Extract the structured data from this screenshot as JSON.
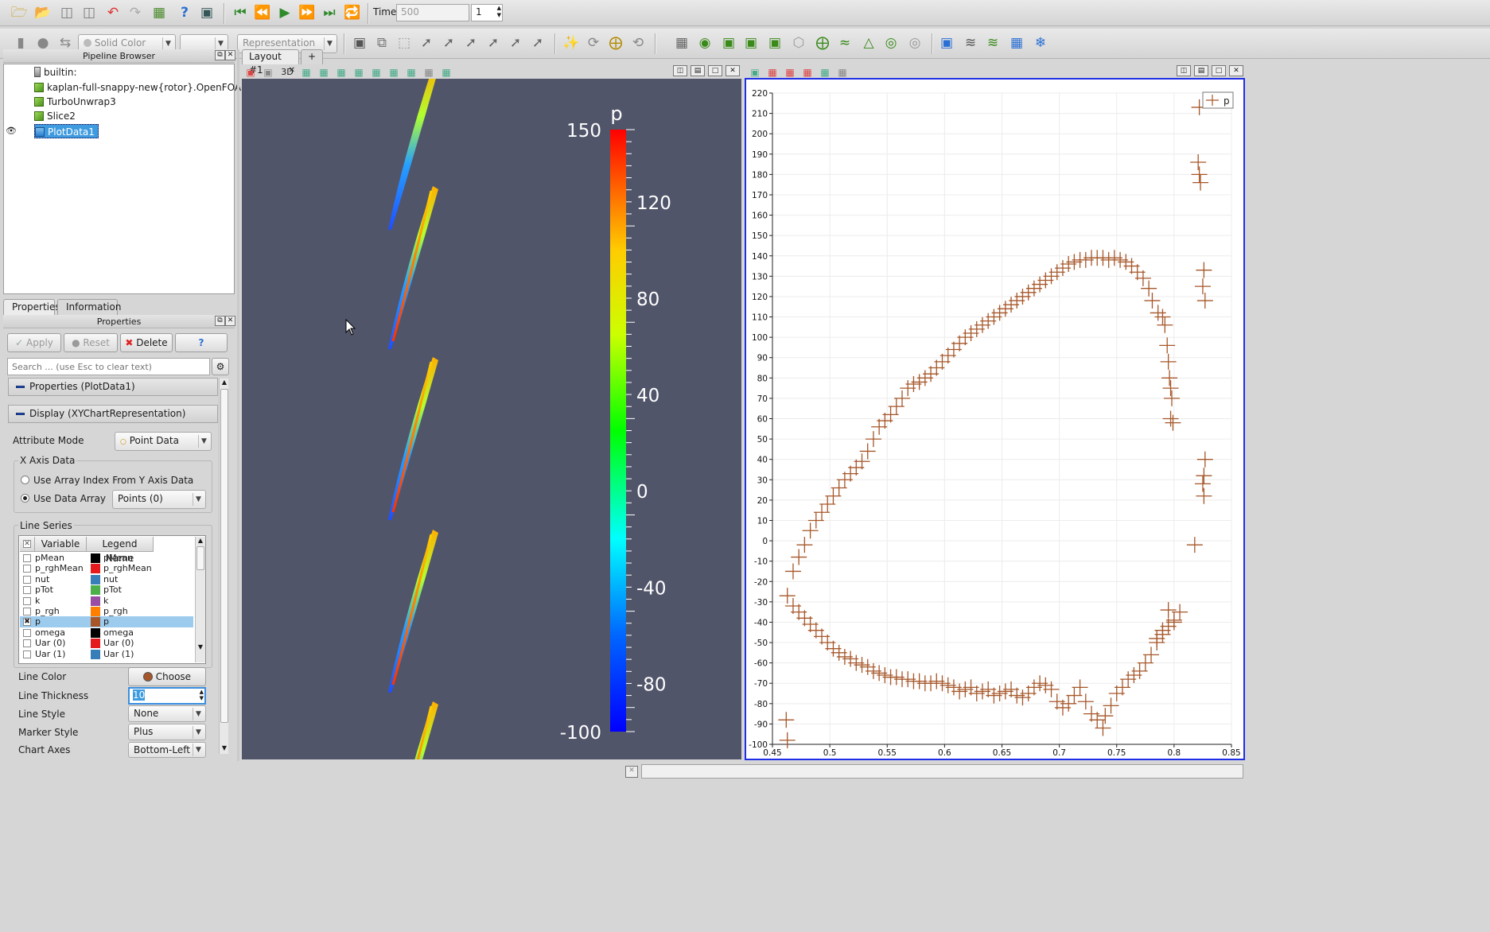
{
  "toolbar1": {
    "time_label": "Time:",
    "time_value": "500",
    "timestep_value": "1"
  },
  "toolbar2": {
    "color_combo": "Solid Color",
    "component_combo": "",
    "representation_combo": "Representation"
  },
  "pipeline_browser": {
    "title": "Pipeline Browser",
    "items": [
      {
        "label": "builtin:"
      },
      {
        "label": "kaplan-full-snappy-new{rotor}.OpenFOAM"
      },
      {
        "label": "TurboUnwrap3"
      },
      {
        "label": "Slice2"
      },
      {
        "label": "PlotData1",
        "selected": true,
        "visible": true
      }
    ]
  },
  "tabs": {
    "properties": "Properties",
    "information": "Information"
  },
  "properties_panel": {
    "title": "Properties",
    "apply": "Apply",
    "reset": "Reset",
    "delete": "Delete",
    "help": "?",
    "search_placeholder": "Search ... (use Esc to clear text)",
    "section_properties": "Properties (PlotData1)",
    "section_display": "Display (XYChartRepresentation)",
    "attribute_mode_label": "Attribute Mode",
    "attribute_mode_value": "Point Data",
    "x_axis_group": "X Axis Data",
    "x_axis_option1": "Use Array Index From Y Axis Data",
    "x_axis_option2": "Use Data Array",
    "x_axis_array": "Points (0)",
    "line_series_group": "Line Series",
    "col_variable": "Variable",
    "col_legend": "Legend Name",
    "series": [
      {
        "variable": "pMean",
        "legend": "pMean",
        "color": "#000000",
        "checked": false
      },
      {
        "variable": "p_rghMean",
        "legend": "p_rghMean",
        "color": "#e41a1c",
        "checked": false
      },
      {
        "variable": "nut",
        "legend": "nut",
        "color": "#377eb8",
        "checked": false
      },
      {
        "variable": "pTot",
        "legend": "pTot",
        "color": "#4daf4a",
        "checked": false
      },
      {
        "variable": "k",
        "legend": "k",
        "color": "#984ea3",
        "checked": false
      },
      {
        "variable": "p_rgh",
        "legend": "p_rgh",
        "color": "#ff7f00",
        "checked": false
      },
      {
        "variable": "p",
        "legend": "p",
        "color": "#a65628",
        "checked": true
      },
      {
        "variable": "omega",
        "legend": "omega",
        "color": "#000000",
        "checked": false
      },
      {
        "variable": "Uar (0)",
        "legend": "Uar (0)",
        "color": "#e41a1c",
        "checked": false
      },
      {
        "variable": "Uar (1)",
        "legend": "Uar (1)",
        "color": "#377eb8",
        "checked": false
      }
    ],
    "line_color_label": "Line Color",
    "line_color_button": "Choose Color...",
    "line_thickness_label": "Line Thickness",
    "line_thickness_value": "10",
    "line_style_label": "Line Style",
    "line_style_value": "None",
    "marker_style_label": "Marker Style",
    "marker_style_value": "Plus",
    "chart_axes_label": "Chart Axes",
    "chart_axes_value": "Bottom-Left"
  },
  "layout": {
    "tab_label": "Layout #1",
    "add_tab": "+",
    "view_3d_label": "3D"
  },
  "colors": {
    "series": "#a65628",
    "chart_border": "#1f2ee6",
    "render_bg": "#51556a"
  },
  "colorbar": {
    "title": "p",
    "min_label": "-100",
    "max_label": "150",
    "tick_labels": [
      "120",
      "80",
      "40",
      "0",
      "-40",
      "-80"
    ]
  },
  "chart_data": {
    "type": "scatter",
    "marker": "plus",
    "xlim": [
      0.45,
      0.85
    ],
    "ylim": [
      -100,
      220
    ],
    "x_ticks": [
      "0.45",
      "0.5",
      "0.55",
      "0.6",
      "0.65",
      "0.7",
      "0.75",
      "0.8",
      "0.85"
    ],
    "y_ticks": [
      "220",
      "210",
      "200",
      "190",
      "180",
      "170",
      "160",
      "150",
      "140",
      "130",
      "120",
      "110",
      "100",
      "90",
      "80",
      "70",
      "60",
      "50",
      "40",
      "30",
      "20",
      "10",
      "0",
      "-10",
      "-20",
      "-30",
      "-40",
      "-50",
      "-60",
      "-70",
      "-80",
      "-90",
      "-100"
    ],
    "legend_position": "top-right",
    "grid": true,
    "series": [
      {
        "name": "p",
        "points": [
          [
            0.463,
            -27
          ],
          [
            0.468,
            -32
          ],
          [
            0.473,
            -35
          ],
          [
            0.478,
            -38
          ],
          [
            0.483,
            -41
          ],
          [
            0.488,
            -44
          ],
          [
            0.493,
            -47
          ],
          [
            0.498,
            -50
          ],
          [
            0.503,
            -53
          ],
          [
            0.508,
            -55
          ],
          [
            0.513,
            -57
          ],
          [
            0.518,
            -58
          ],
          [
            0.523,
            -60
          ],
          [
            0.528,
            -61
          ],
          [
            0.533,
            -62
          ],
          [
            0.538,
            -64
          ],
          [
            0.543,
            -65
          ],
          [
            0.548,
            -66
          ],
          [
            0.553,
            -67
          ],
          [
            0.558,
            -67
          ],
          [
            0.563,
            -68
          ],
          [
            0.568,
            -68
          ],
          [
            0.573,
            -69
          ],
          [
            0.578,
            -69
          ],
          [
            0.583,
            -70
          ],
          [
            0.588,
            -70
          ],
          [
            0.593,
            -69
          ],
          [
            0.598,
            -70
          ],
          [
            0.603,
            -71
          ],
          [
            0.608,
            -72
          ],
          [
            0.613,
            -74
          ],
          [
            0.618,
            -73
          ],
          [
            0.623,
            -72
          ],
          [
            0.628,
            -75
          ],
          [
            0.633,
            -74
          ],
          [
            0.638,
            -73
          ],
          [
            0.643,
            -76
          ],
          [
            0.648,
            -75
          ],
          [
            0.653,
            -74
          ],
          [
            0.658,
            -73
          ],
          [
            0.663,
            -76
          ],
          [
            0.668,
            -77
          ],
          [
            0.673,
            -75
          ],
          [
            0.678,
            -72
          ],
          [
            0.683,
            -70
          ],
          [
            0.688,
            -71
          ],
          [
            0.693,
            -73
          ],
          [
            0.698,
            -79
          ],
          [
            0.703,
            -82
          ],
          [
            0.708,
            -80
          ],
          [
            0.713,
            -76
          ],
          [
            0.718,
            -72
          ],
          [
            0.723,
            -79
          ],
          [
            0.728,
            -85
          ],
          [
            0.733,
            -88
          ],
          [
            0.738,
            -92
          ],
          [
            0.74,
            -86
          ],
          [
            0.745,
            -81
          ],
          [
            0.75,
            -75
          ],
          [
            0.755,
            -72
          ],
          [
            0.76,
            -68
          ],
          [
            0.765,
            -66
          ],
          [
            0.77,
            -64
          ],
          [
            0.775,
            -60
          ],
          [
            0.78,
            -56
          ],
          [
            0.785,
            -50
          ],
          [
            0.79,
            -46
          ],
          [
            0.795,
            -42
          ],
          [
            0.8,
            -39
          ],
          [
            0.805,
            -35
          ],
          [
            0.79,
            -44
          ],
          [
            0.785,
            -48
          ],
          [
            0.795,
            -34
          ],
          [
            0.8,
            -40
          ],
          [
            0.468,
            -15
          ],
          [
            0.473,
            -8
          ],
          [
            0.478,
            -2
          ],
          [
            0.483,
            5
          ],
          [
            0.488,
            10
          ],
          [
            0.493,
            14
          ],
          [
            0.498,
            18
          ],
          [
            0.503,
            22
          ],
          [
            0.508,
            26
          ],
          [
            0.513,
            30
          ],
          [
            0.518,
            33
          ],
          [
            0.523,
            36
          ],
          [
            0.528,
            39
          ],
          [
            0.533,
            44
          ],
          [
            0.538,
            50
          ],
          [
            0.543,
            56
          ],
          [
            0.548,
            59
          ],
          [
            0.553,
            62
          ],
          [
            0.558,
            66
          ],
          [
            0.563,
            70
          ],
          [
            0.568,
            75
          ],
          [
            0.573,
            77
          ],
          [
            0.578,
            78
          ],
          [
            0.583,
            80
          ],
          [
            0.588,
            82
          ],
          [
            0.593,
            85
          ],
          [
            0.598,
            88
          ],
          [
            0.603,
            91
          ],
          [
            0.608,
            94
          ],
          [
            0.613,
            97
          ],
          [
            0.618,
            100
          ],
          [
            0.623,
            102
          ],
          [
            0.628,
            104
          ],
          [
            0.633,
            106
          ],
          [
            0.638,
            108
          ],
          [
            0.643,
            110
          ],
          [
            0.648,
            112
          ],
          [
            0.653,
            114
          ],
          [
            0.658,
            116
          ],
          [
            0.663,
            118
          ],
          [
            0.668,
            120
          ],
          [
            0.673,
            122
          ],
          [
            0.678,
            124
          ],
          [
            0.683,
            126
          ],
          [
            0.688,
            128
          ],
          [
            0.693,
            130
          ],
          [
            0.698,
            132
          ],
          [
            0.703,
            134
          ],
          [
            0.708,
            136
          ],
          [
            0.713,
            137
          ],
          [
            0.718,
            138
          ],
          [
            0.723,
            138
          ],
          [
            0.728,
            139
          ],
          [
            0.733,
            139
          ],
          [
            0.738,
            139
          ],
          [
            0.743,
            138
          ],
          [
            0.748,
            139
          ],
          [
            0.753,
            138
          ],
          [
            0.758,
            137
          ],
          [
            0.763,
            135
          ],
          [
            0.768,
            132
          ],
          [
            0.773,
            129
          ],
          [
            0.778,
            124
          ],
          [
            0.781,
            118
          ],
          [
            0.786,
            112
          ],
          [
            0.79,
            110
          ],
          [
            0.792,
            106
          ],
          [
            0.794,
            96
          ],
          [
            0.795,
            88
          ],
          [
            0.796,
            80
          ],
          [
            0.797,
            75
          ],
          [
            0.798,
            70
          ],
          [
            0.797,
            60
          ],
          [
            0.799,
            58
          ],
          [
            0.818,
            -2
          ],
          [
            0.825,
            28
          ],
          [
            0.826,
            32
          ],
          [
            0.827,
            40
          ],
          [
            0.826,
            22
          ],
          [
            0.825,
            125
          ],
          [
            0.826,
            133
          ],
          [
            0.827,
            118
          ],
          [
            0.822,
            180
          ],
          [
            0.821,
            186
          ],
          [
            0.823,
            176
          ],
          [
            0.822,
            213
          ],
          [
            0.462,
            -88
          ],
          [
            0.463,
            -98
          ]
        ]
      }
    ]
  }
}
